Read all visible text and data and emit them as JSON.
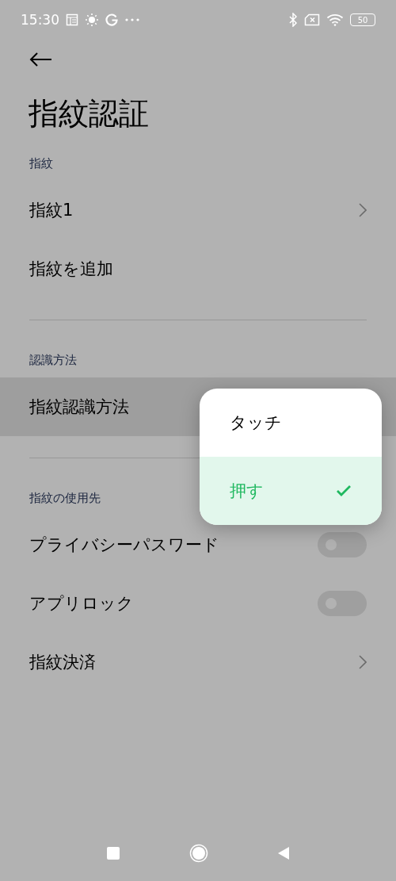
{
  "status_bar": {
    "time": "15:30",
    "battery": "50"
  },
  "title": "指紋認証",
  "sections": [
    {
      "header": "指紋",
      "items": [
        {
          "label": "指紋1",
          "kind": "link",
          "highlighted": false
        },
        {
          "label": "指紋を追加",
          "kind": "plain",
          "highlighted": false
        }
      ]
    },
    {
      "header": "認識方法",
      "items": [
        {
          "label": "指紋認識方法",
          "kind": "plain",
          "highlighted": true
        }
      ]
    },
    {
      "header": "指紋の使用先",
      "items": [
        {
          "label": "プライバシーパスワード",
          "kind": "toggle",
          "on": false,
          "highlighted": false
        },
        {
          "label": "アプリロック",
          "kind": "toggle",
          "on": false,
          "highlighted": false
        },
        {
          "label": "指紋決済",
          "kind": "link",
          "highlighted": false
        }
      ]
    }
  ],
  "popup": {
    "options": [
      {
        "label": "タッチ",
        "selected": false
      },
      {
        "label": "押す",
        "selected": true
      }
    ]
  }
}
